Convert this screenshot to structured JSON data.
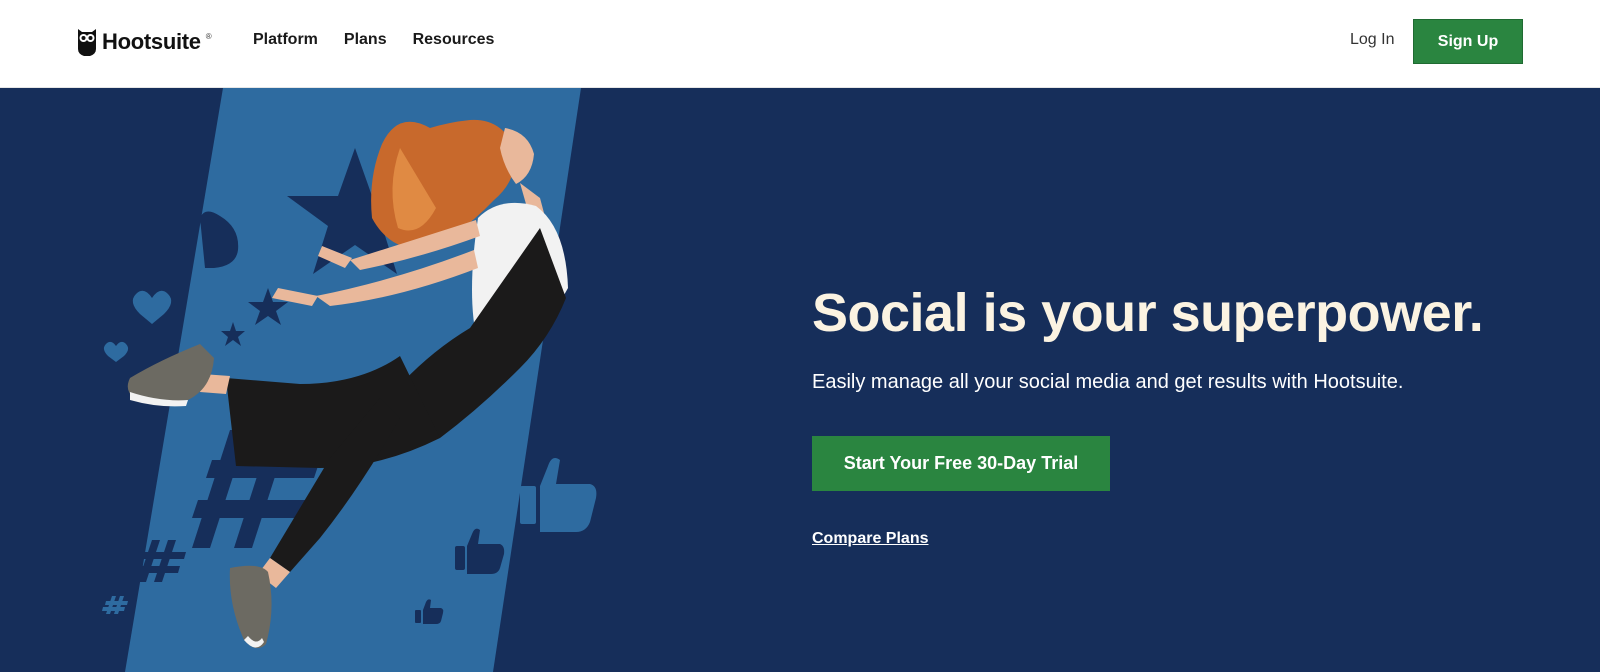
{
  "nav": {
    "brand": "Hootsuite",
    "brand_mark": "®",
    "links": [
      {
        "label": "Platform"
      },
      {
        "label": "Plans"
      },
      {
        "label": "Resources"
      }
    ],
    "login_label": "Log In",
    "signup_label": "Sign Up"
  },
  "hero": {
    "headline": "Social is your superpower.",
    "subhead": "Easily manage all your social media and get results with Hootsuite.",
    "cta_label": "Start Your Free 30-Day Trial",
    "compare_label": "Compare Plans",
    "image_subject": "woman-jumping-illustration"
  },
  "colors": {
    "brand_green": "#2a8540",
    "hero_navy": "#162e5a",
    "hero_stripe": "#2e6ba0",
    "headline_cream": "#fbf3e2"
  }
}
